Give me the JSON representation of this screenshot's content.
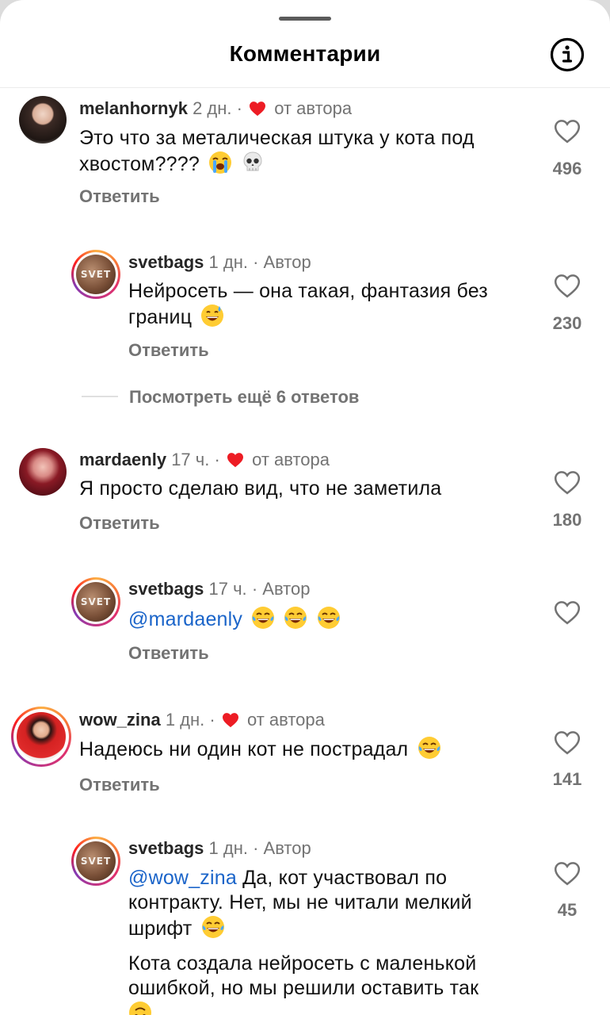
{
  "header": {
    "title": "Комментарии",
    "info_icon": "info-icon"
  },
  "colors": {
    "heart": "#ed1c24",
    "mention": "#1a64c9",
    "meta": "#737373"
  },
  "comments": [
    {
      "username": "melanhornyk",
      "time": "2 дн.",
      "sep": "·",
      "badge": "от автора",
      "text": "Это что за металическая штука у кота под хвостом????",
      "reply_label": "Ответить",
      "likes": "496"
    },
    {
      "username": "svetbags",
      "time": "1 дн.",
      "sep": "·",
      "badge": "Автор",
      "text": "Нейросеть — она такая, фантазия без границ",
      "reply_label": "Ответить",
      "likes": "230"
    },
    {
      "username": "mardaenly",
      "time": "17 ч.",
      "sep": "·",
      "badge": "от автора",
      "text": "Я просто сделаю вид, что не заметила",
      "reply_label": "Ответить",
      "likes": "180"
    },
    {
      "username": "svetbags",
      "time": "17 ч.",
      "sep": "·",
      "badge": "Автор",
      "mention": "@mardaenly",
      "reply_label": "Ответить"
    },
    {
      "username": "wow_zina",
      "time": "1 дн.",
      "sep": "·",
      "badge": "от автора",
      "text": "Надеюсь ни один кот не пострадал",
      "reply_label": "Ответить",
      "likes": "141"
    },
    {
      "username": "svetbags",
      "time": "1 дн.",
      "sep": "·",
      "badge": "Автор",
      "mention": "@wow_zina",
      "text_line1": "Да, кот участвовал по",
      "text_line2": "контракту. Нет, мы не читали мелкий",
      "text_line3": "шрифт",
      "text_p2_line1": "Кота создала нейросеть с маленькой",
      "text_p2_line2": "ошибкой, но мы решили оставить так",
      "likes": "45"
    }
  ],
  "view_more": "Посмотреть ещё 6 ответов",
  "avatar_logo": "SVET"
}
